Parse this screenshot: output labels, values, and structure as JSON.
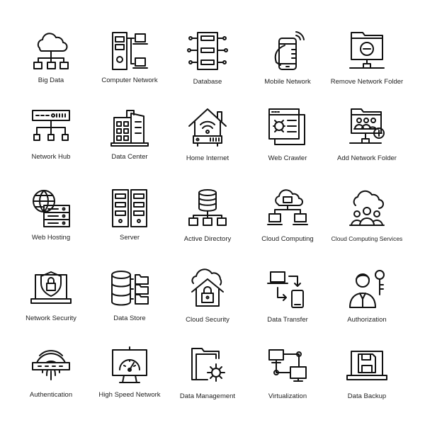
{
  "icon_color": "#111111",
  "items": [
    {
      "label": "Big Data",
      "icon": "cloud-hierarchy-icon"
    },
    {
      "label": "Computer Network",
      "icon": "tower-laptops-icon"
    },
    {
      "label": "Database",
      "icon": "server-circuit-icon"
    },
    {
      "label": "Mobile Network",
      "icon": "hand-phone-signal-icon"
    },
    {
      "label": "Remove Network Folder",
      "icon": "folder-minus-network-icon"
    },
    {
      "label": "Network Hub",
      "icon": "hub-icon"
    },
    {
      "label": "Data Center",
      "icon": "buildings-icon"
    },
    {
      "label": "Home Internet",
      "icon": "house-wifi-router-icon"
    },
    {
      "label": "Web Crawler",
      "icon": "browser-bug-icon"
    },
    {
      "label": "Add Network Folder",
      "icon": "folder-users-plus-icon"
    },
    {
      "label": "Web Hosting",
      "icon": "globe-server-icon"
    },
    {
      "label": "Server",
      "icon": "server-racks-icon"
    },
    {
      "label": "Active Directory",
      "icon": "database-hierarchy-icon"
    },
    {
      "label": "Cloud Computing",
      "icon": "cloud-computers-icon"
    },
    {
      "label": "Cloud Computing Services",
      "icon": "cloud-users-icon"
    },
    {
      "label": "Network Security",
      "icon": "laptop-shield-icon"
    },
    {
      "label": "Data Store",
      "icon": "database-folders-icon"
    },
    {
      "label": "Cloud Security",
      "icon": "cloud-house-lock-icon"
    },
    {
      "label": "Data Transfer",
      "icon": "laptop-phone-arrows-icon"
    },
    {
      "label": "Authorization",
      "icon": "user-key-icon"
    },
    {
      "label": "Authentication",
      "icon": "fingerprint-password-icon"
    },
    {
      "label": "High Speed Network",
      "icon": "monitor-speedometer-icon"
    },
    {
      "label": "Data Management",
      "icon": "folder-gear-icon"
    },
    {
      "label": "Virtualization",
      "icon": "monitors-network-icon"
    },
    {
      "label": "Data Backup",
      "icon": "laptop-floppy-icon"
    }
  ]
}
